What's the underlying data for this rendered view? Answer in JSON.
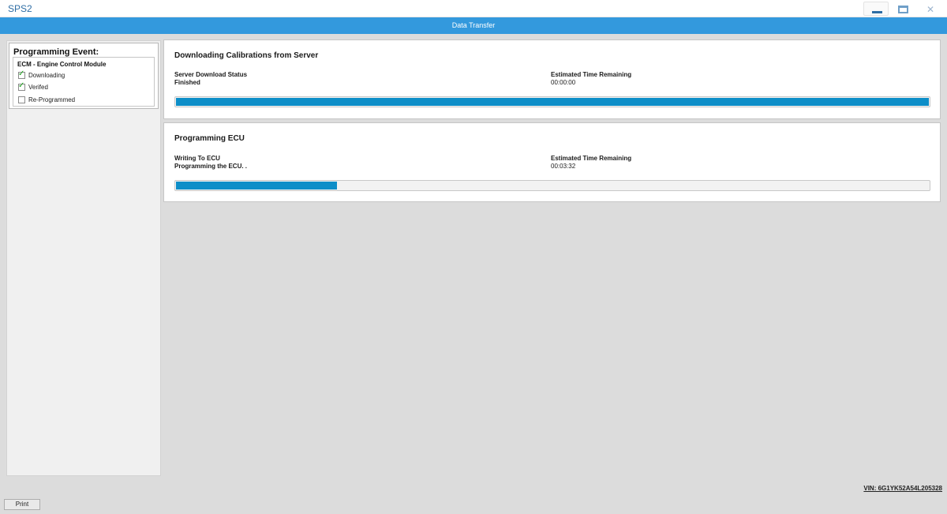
{
  "window": {
    "app_title": "SPS2"
  },
  "header": {
    "title": "Data Transfer"
  },
  "programming_event": {
    "title": "Programming Event:",
    "module": "ECM - Engine Control Module",
    "steps": [
      {
        "label": "Downloading",
        "checked": true
      },
      {
        "label": "Verifed",
        "checked": true
      },
      {
        "label": "Re-Programmed",
        "checked": false
      }
    ]
  },
  "download_card": {
    "title": "Downloading Calibrations from Server",
    "status_label": "Server Download Status",
    "status_value": "Finished",
    "time_label": "Estimated Time Remaining",
    "time_value": "00:00:00",
    "progress_percent": 100
  },
  "programming_card": {
    "title": "Programming ECU",
    "status_label": "Writing To ECU",
    "status_value": "Programming the ECU. .",
    "time_label": "Estimated Time Remaining",
    "time_value": "00:03:32",
    "progress_percent": 21.6
  },
  "footer": {
    "vin": "VIN: 6G1YK52A54L205328",
    "print_label": "Print"
  },
  "colors": {
    "accent": "#3399dd",
    "progress": "#0d8ec8",
    "check": "#1aa01a"
  },
  "icons": [
    "minimize-icon",
    "maximize-icon",
    "close-icon",
    "checkmark-icon"
  ]
}
